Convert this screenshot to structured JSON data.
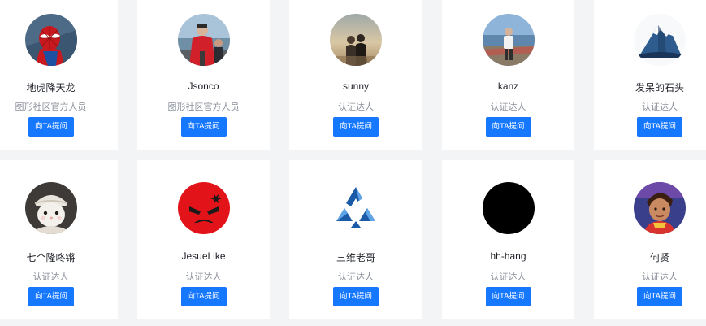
{
  "ask_label": "向TA提问",
  "colors": {
    "accent": "#1677ff",
    "background": "#f3f4f6",
    "card": "#ffffff"
  },
  "experts": [
    {
      "name": "地虎降天龙",
      "role": "图形社区官方人员",
      "avatar": "spiderman-avatar"
    },
    {
      "name": "Jsonco",
      "role": "图形社区官方人员",
      "avatar": "person-red-jacket-avatar"
    },
    {
      "name": "sunny",
      "role": "认证达人",
      "avatar": "couple-sunset-avatar"
    },
    {
      "name": "kanz",
      "role": "认证达人",
      "avatar": "person-lakeside-avatar"
    },
    {
      "name": "发呆的石头",
      "role": "认证达人",
      "avatar": "snow-mountain-avatar"
    },
    {
      "name": "七个隆咚锵",
      "role": "认证达人",
      "avatar": "white-rabbit-avatar"
    },
    {
      "name": "JesueLike",
      "role": "认证达人",
      "avatar": "angry-face-avatar"
    },
    {
      "name": "三维老哥",
      "role": "认证达人",
      "avatar": "blue-triangle-logo-avatar"
    },
    {
      "name": "hh-hang",
      "role": "认证达人",
      "avatar": "black-circle-avatar"
    },
    {
      "name": "何贤",
      "role": "认证达人",
      "avatar": "cartoon-boy-avatar"
    }
  ]
}
